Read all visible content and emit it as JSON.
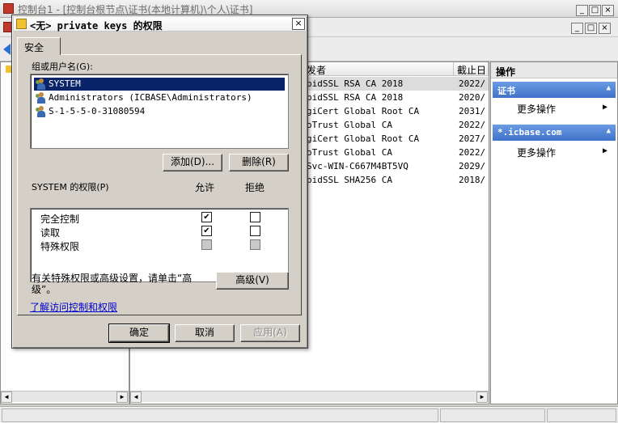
{
  "mmc": {
    "title": "控制台1 - [控制台根节点\\证书(本地计算机)\\个人\\证书]",
    "window_buttons": [
      "_",
      "□",
      "×"
    ],
    "inner_buttons": [
      "_",
      "□",
      "×"
    ],
    "list_headers": [
      "发者",
      "截止日"
    ],
    "list_rows": [
      {
        "issuer": "pidSSL RSA CA 2018",
        "expires": "2022/"
      },
      {
        "issuer": "pidSSL RSA CA 2018",
        "expires": "2020/"
      },
      {
        "issuer": "giCert Global Root CA",
        "expires": "2031/"
      },
      {
        "issuer": "oTrust Global CA",
        "expires": "2022/"
      },
      {
        "issuer": "giCert Global Root CA",
        "expires": "2027/"
      },
      {
        "issuer": "oTrust Global CA",
        "expires": "2022/"
      },
      {
        "issuer": "Svc-WIN-C667M4BT5VQ",
        "expires": "2029/"
      },
      {
        "issuer": "pidSSL SHA256 CA",
        "expires": "2018/"
      }
    ],
    "actions": {
      "header": "操作",
      "groups": [
        {
          "title": "证书",
          "item": "更多操作"
        },
        {
          "title": "*.icbase.com",
          "item": "更多操作"
        }
      ]
    }
  },
  "dialog": {
    "title": "<无> private keys 的权限",
    "close": "×",
    "tab": "安全",
    "group_label": "组或用户名(G):",
    "users": [
      {
        "name": "SYSTEM",
        "selected": true
      },
      {
        "name": "Administrators (ICBASE\\Administrators)",
        "selected": false
      },
      {
        "name": "S-1-5-5-0-31080594",
        "selected": false
      }
    ],
    "add_button": "添加(D)...",
    "remove_button": "删除(R)",
    "perm_label": "SYSTEM 的权限(P)",
    "allow_label": "允许",
    "deny_label": "拒绝",
    "permissions": [
      {
        "name": "完全控制",
        "allow": "checked",
        "deny": "unchecked"
      },
      {
        "name": "读取",
        "allow": "checked",
        "deny": "unchecked"
      },
      {
        "name": "特殊权限",
        "allow": "disabled",
        "deny": "disabled"
      }
    ],
    "advanced_text": "有关特殊权限或高级设置，请单击“高级”。",
    "advanced_button": "高级(V)",
    "learn_link": "了解访问控制和权限",
    "ok": "确定",
    "cancel": "取消",
    "apply": "应用(A)"
  }
}
